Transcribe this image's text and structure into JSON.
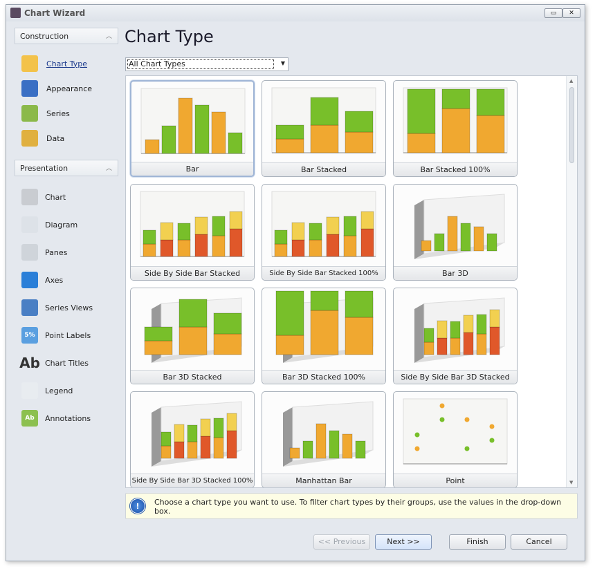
{
  "window": {
    "title": "Chart Wizard",
    "minimize_icon": "restore-icon",
    "close_icon": "close-icon"
  },
  "sidebar": {
    "construction": {
      "label": "Construction",
      "items": [
        {
          "label": "Chart Type",
          "icon": "bar-chart-icon",
          "selected": true
        },
        {
          "label": "Appearance",
          "icon": "palette-icon"
        },
        {
          "label": "Series",
          "icon": "series-icon"
        },
        {
          "label": "Data",
          "icon": "database-icon"
        }
      ]
    },
    "presentation": {
      "label": "Presentation",
      "items": [
        {
          "label": "Chart",
          "icon": "wrench-icon"
        },
        {
          "label": "Diagram",
          "icon": "diagram-icon"
        },
        {
          "label": "Panes",
          "icon": "panes-icon"
        },
        {
          "label": "Axes",
          "icon": "axes-arrow-icon"
        },
        {
          "label": "Series Views",
          "icon": "series-views-icon"
        },
        {
          "label": "Point Labels",
          "icon": "point-labels-icon",
          "glyph": "5%"
        },
        {
          "label": "Chart Titles",
          "icon": "chart-titles-icon",
          "glyph": "Ab"
        },
        {
          "label": "Legend",
          "icon": "legend-icon"
        },
        {
          "label": "Annotations",
          "icon": "annotations-icon",
          "glyph": "Ab"
        }
      ]
    }
  },
  "main": {
    "title": "Chart Type",
    "filter": {
      "value": "All Chart Types"
    },
    "chart_types": [
      {
        "label": "Bar",
        "kind": "bar",
        "selected": true
      },
      {
        "label": "Bar Stacked",
        "kind": "stacked"
      },
      {
        "label": "Bar Stacked 100%",
        "kind": "stacked100"
      },
      {
        "label": "Side By Side Bar Stacked",
        "kind": "sbs"
      },
      {
        "label": "Side By Side Bar Stacked 100%",
        "kind": "sbs100"
      },
      {
        "label": "Bar 3D",
        "kind": "bar3d"
      },
      {
        "label": "Bar 3D Stacked",
        "kind": "stacked3d"
      },
      {
        "label": "Bar 3D Stacked 100%",
        "kind": "stacked3d100"
      },
      {
        "label": "Side By Side Bar 3D Stacked",
        "kind": "sbs3d"
      },
      {
        "label": "Side By Side Bar 3D Stacked 100%",
        "kind": "sbs3d100"
      },
      {
        "label": "Manhattan Bar",
        "kind": "manhattan"
      },
      {
        "label": "Point",
        "kind": "point"
      }
    ],
    "hint": "Choose a chart type you want to use. To filter chart types by their groups, use the values in the drop-down box."
  },
  "buttons": {
    "previous": "<< Previous",
    "next": "Next >>",
    "finish": "Finish",
    "cancel": "Cancel"
  },
  "colors": {
    "orange": "#f0a830",
    "green": "#78bf2a",
    "red": "#e0582a",
    "yellow": "#f2d050",
    "accent": "#1b3a8c"
  }
}
